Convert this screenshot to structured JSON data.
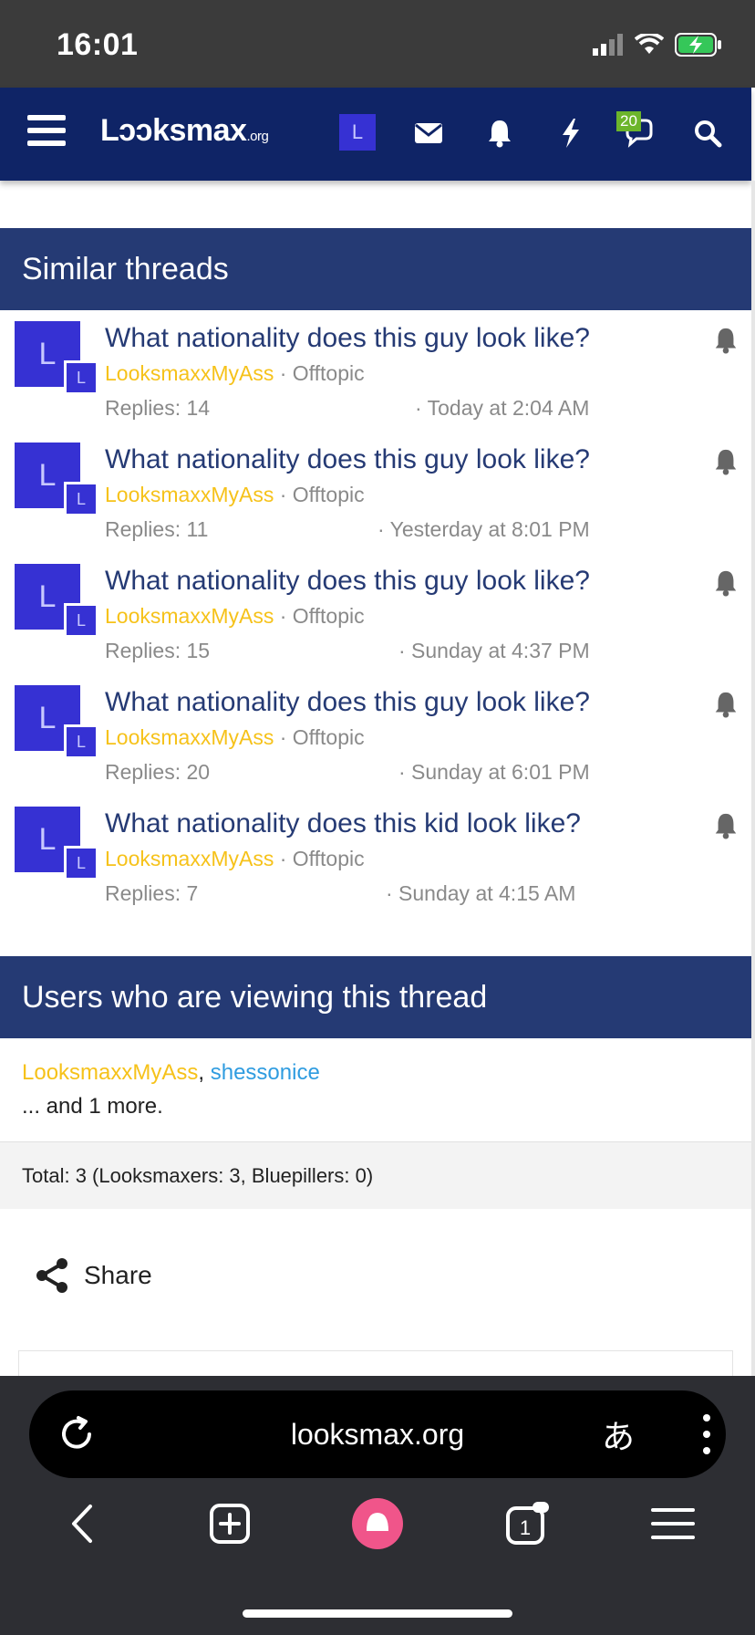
{
  "status_bar": {
    "time": "16:01"
  },
  "header": {
    "logo_main": "Lɔɔksmax",
    "logo_org": ".org",
    "avatar_letter": "L",
    "alerts_badge": "20"
  },
  "similar": {
    "title": "Similar threads",
    "threads": [
      {
        "avatar": "L",
        "title": "What nationality does this guy look like?",
        "author": "LooksmaxxMyAss",
        "forum": "· Offtopic",
        "replies": "Replies: 14",
        "date": "· Today at 2:04 AM"
      },
      {
        "avatar": "L",
        "title": "What nationality does this guy look like?",
        "author": "LooksmaxxMyAss",
        "forum": "· Offtopic",
        "replies": "Replies: 11",
        "date": "· Yesterday at 8:01 PM"
      },
      {
        "avatar": "L",
        "title": "What nationality does this guy look like?",
        "author": "LooksmaxxMyAss",
        "forum": "· Offtopic",
        "replies": "Replies: 15",
        "date": "· Sunday at 4:37 PM"
      },
      {
        "avatar": "L",
        "title": "What nationality does this guy look like?",
        "author": "LooksmaxxMyAss",
        "forum": "· Offtopic",
        "replies": "Replies: 20",
        "date": "· Sunday at 6:01 PM"
      },
      {
        "avatar": "L",
        "title": "What nationality does this kid look like?",
        "author": "LooksmaxxMyAss",
        "forum": "· Offtopic",
        "replies": "Replies: 7",
        "date": "· Sunday at 4:15 AM"
      }
    ]
  },
  "viewing": {
    "title": "Users who are viewing this thread",
    "user1": "LooksmaxxMyAss",
    "separator": ",",
    "user2": "shessonice",
    "more": "... and 1 more.",
    "total": "Total: 3 (Looksmaxers: 3, Bluepillers: 0)"
  },
  "share": {
    "label": "Share"
  },
  "browser": {
    "url": "looksmax.org",
    "translate": "あ",
    "tabs_count": "1"
  }
}
